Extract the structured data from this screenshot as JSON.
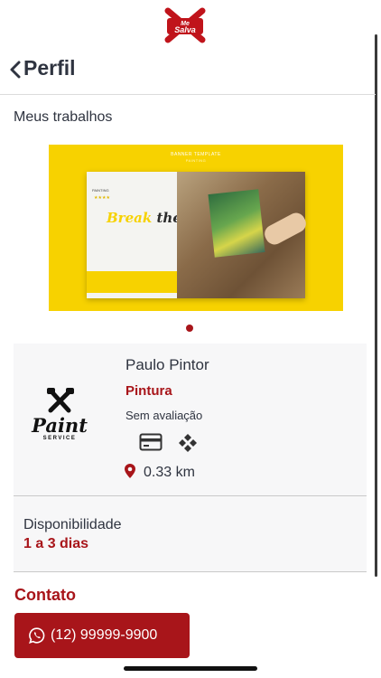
{
  "app": {
    "logo_text": "Me Salva"
  },
  "header": {
    "title": "Perfil"
  },
  "works": {
    "section_label": "Meus trabalhos",
    "banner": {
      "top_text": "BANNER TEMPLATE",
      "sub_text": "PAINTING",
      "brand_text": "PAINTING",
      "headline_part1": "Break",
      "headline_part2": "the rules"
    },
    "carousel": {
      "active_index": 0,
      "count": 1
    }
  },
  "professional": {
    "logo_word": "Paint",
    "logo_service": "SERVICE",
    "name": "Paulo Pintor",
    "category": "Pintura",
    "rating_text": "Sem avaliação",
    "payment_icons": [
      "credit-card-icon",
      "pix-icon"
    ],
    "distance": "0.33 km"
  },
  "availability": {
    "label": "Disponibilidade",
    "value": "1 a 3 dias"
  },
  "contact": {
    "title": "Contato",
    "phone": "(12) 99999-9900"
  },
  "colors": {
    "accent": "#a8151a",
    "text": "#2f3440",
    "banner_yellow": "#f7d200"
  }
}
